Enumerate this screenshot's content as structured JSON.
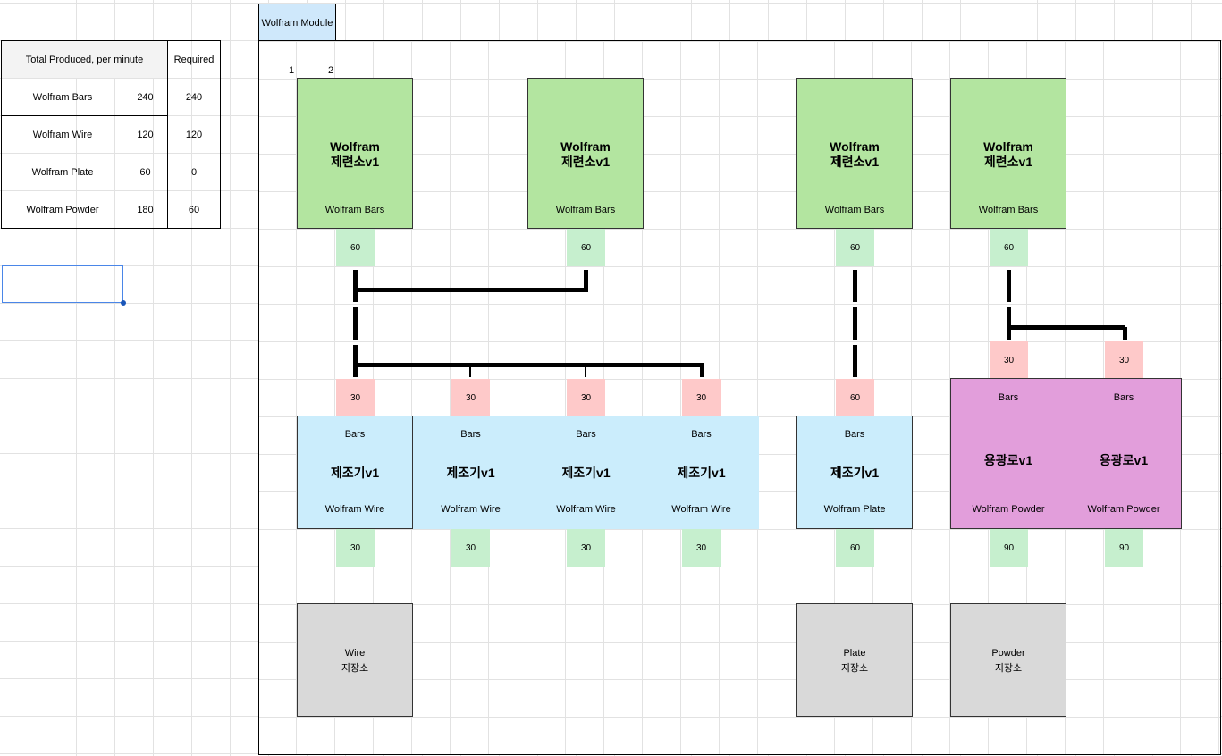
{
  "summary": {
    "header_produced": "Total Produced, per minute",
    "header_required": "Required",
    "rows": [
      {
        "name": "Wolfram Bars",
        "produced": "240",
        "required": "240"
      },
      {
        "name": "Wolfram Wire",
        "produced": "120",
        "required": "120"
      },
      {
        "name": "Wolfram Plate",
        "produced": "60",
        "required": "0"
      },
      {
        "name": "Wolfram Powder",
        "produced": "180",
        "required": "60"
      }
    ]
  },
  "module": {
    "tab_label": "Wolfram Module",
    "col_labels": [
      "1",
      "2"
    ],
    "smelters": [
      {
        "title1": "Wolfram",
        "title2": "제련소v1",
        "output": "Wolfram Bars",
        "rate": "60"
      },
      {
        "title1": "Wolfram",
        "title2": "제련소v1",
        "output": "Wolfram Bars",
        "rate": "60"
      },
      {
        "title1": "Wolfram",
        "title2": "제련소v1",
        "output": "Wolfram Bars",
        "rate": "60"
      },
      {
        "title1": "Wolfram",
        "title2": "제련소v1",
        "output": "Wolfram Bars",
        "rate": "60"
      }
    ],
    "fabricators": [
      {
        "input": "Bars",
        "title": "제조기v1",
        "output": "Wolfram Wire",
        "in_rate": "30",
        "out_rate": "30"
      },
      {
        "input": "Bars",
        "title": "제조기v1",
        "output": "Wolfram Wire",
        "in_rate": "30",
        "out_rate": "30"
      },
      {
        "input": "Bars",
        "title": "제조기v1",
        "output": "Wolfram Wire",
        "in_rate": "30",
        "out_rate": "30"
      },
      {
        "input": "Bars",
        "title": "제조기v1",
        "output": "Wolfram Wire",
        "in_rate": "30",
        "out_rate": "30"
      },
      {
        "input": "Bars",
        "title": "제조기v1",
        "output": "Wolfram Plate",
        "in_rate": "60",
        "out_rate": "60"
      }
    ],
    "furnaces": [
      {
        "input": "Bars",
        "title": "용광로v1",
        "output": "Wolfram Powder",
        "in_rate": "30",
        "out_rate": "90"
      },
      {
        "input": "Bars",
        "title": "용광로v1",
        "output": "Wolfram Powder",
        "in_rate": "30",
        "out_rate": "90"
      }
    ],
    "storages": [
      {
        "item": "Wire",
        "label": "지장소"
      },
      {
        "item": "Plate",
        "label": "지장소"
      },
      {
        "item": "Powder",
        "label": "지장소"
      }
    ]
  },
  "colors": {
    "smelter": "#b3e5a0",
    "fabricator": "#cbedfc",
    "furnace": "#e29edb",
    "storage": "#d9d9d9",
    "output_rate": "#c6efce",
    "input_rate": "#fec9c9",
    "tab": "#cfe8fb"
  }
}
